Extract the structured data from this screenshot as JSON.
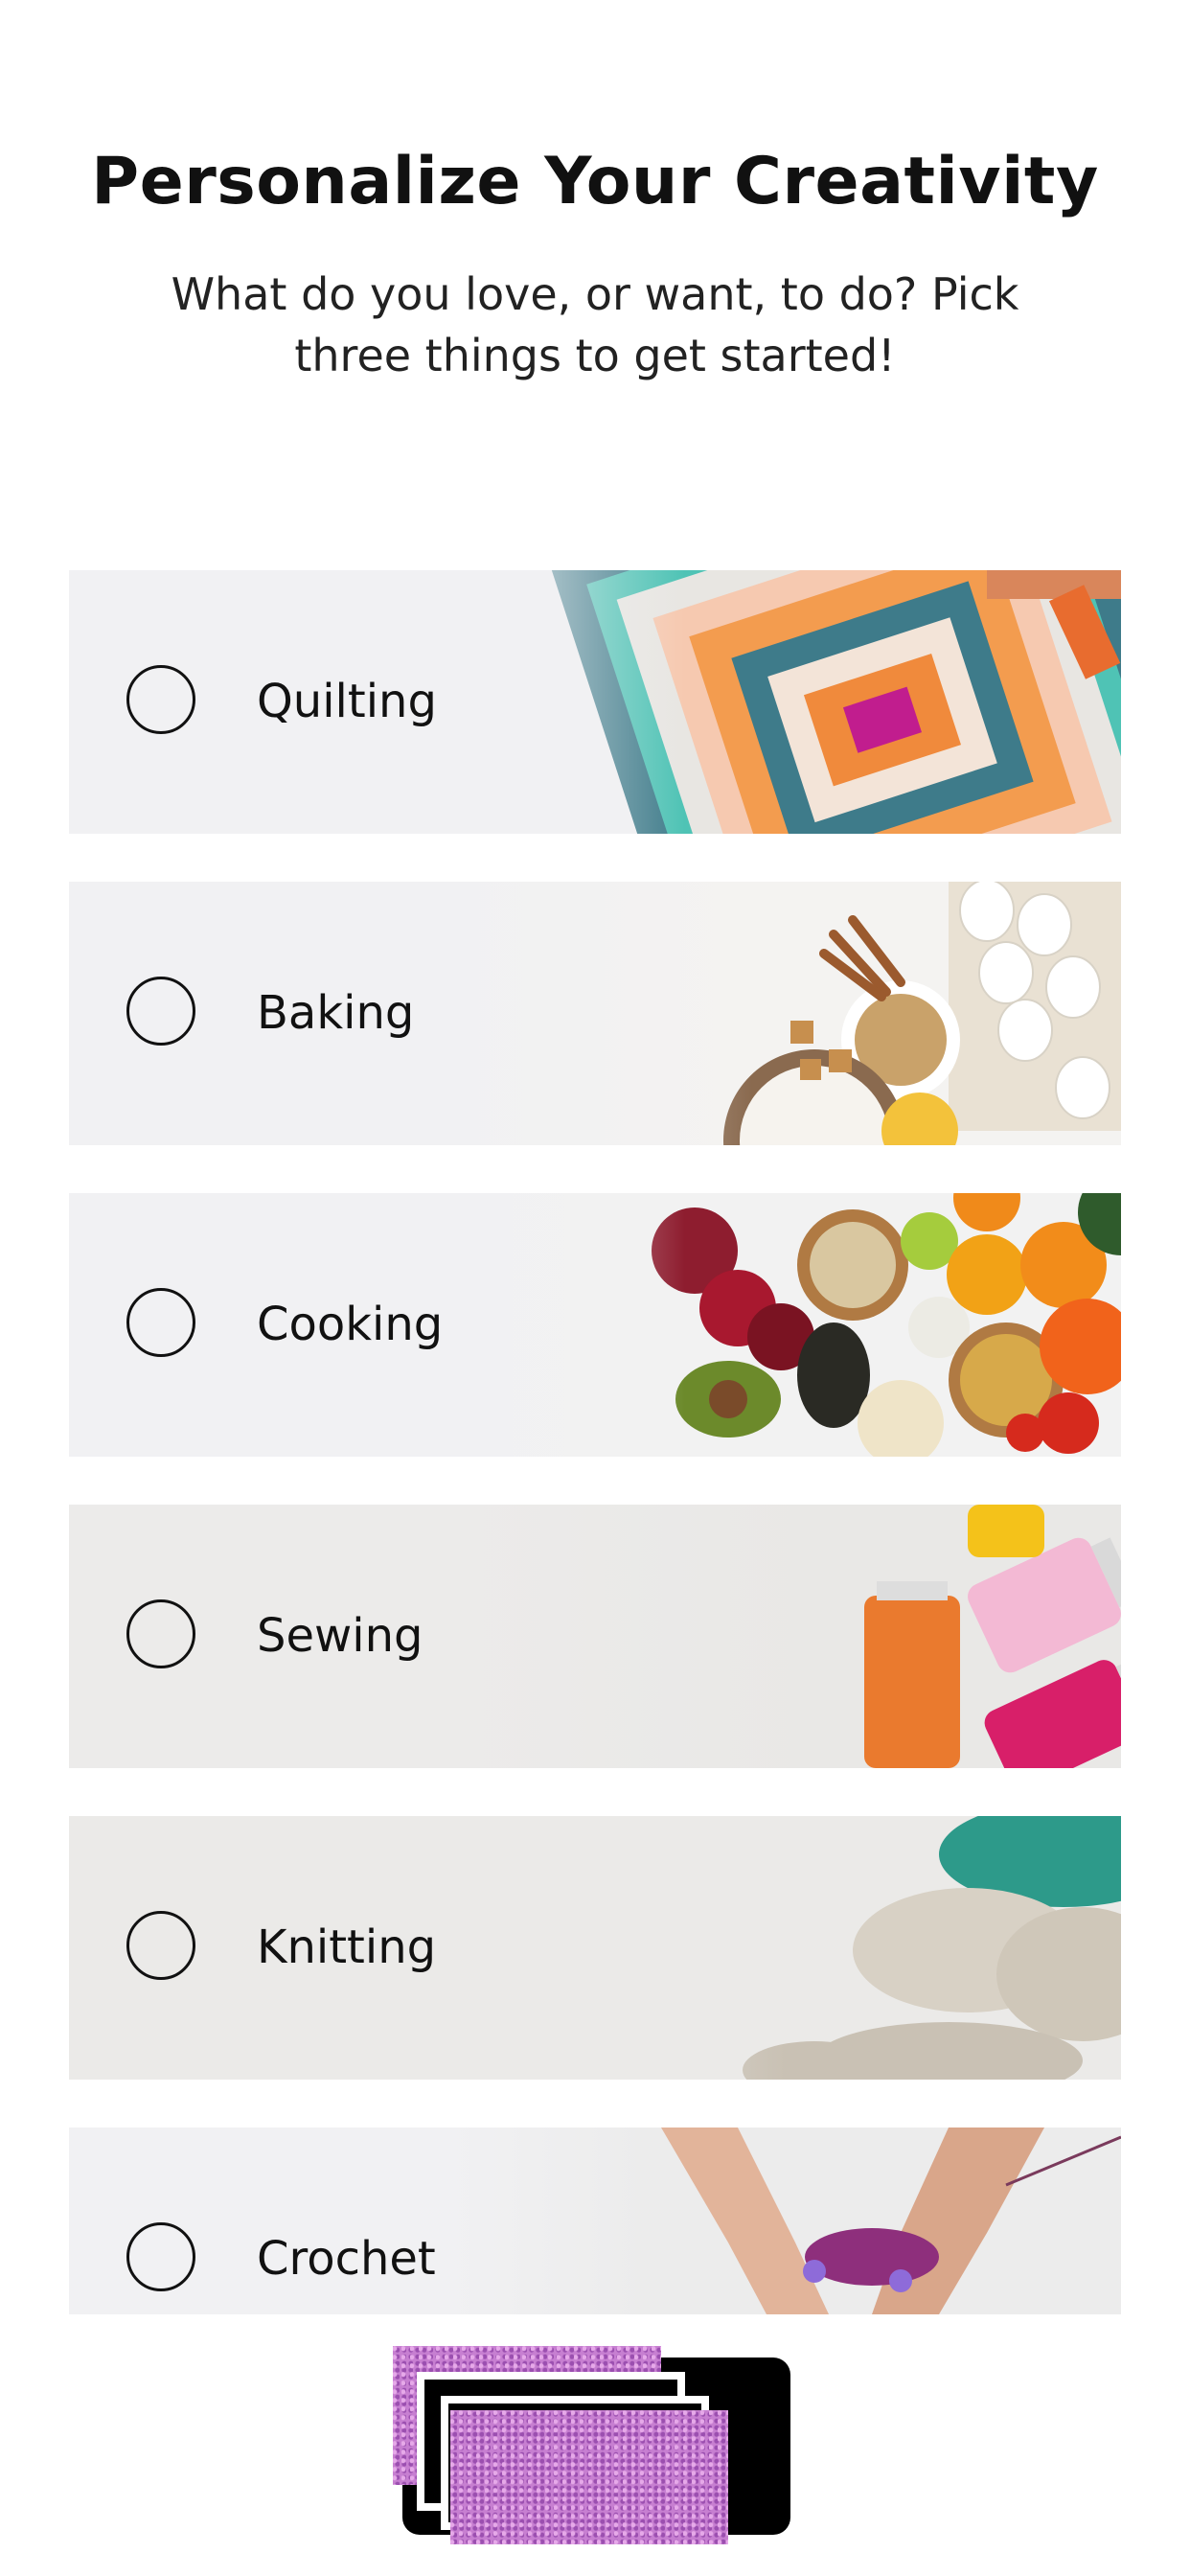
{
  "header": {
    "title": "Personalize Your Creativity",
    "subtitle": "What do you love, or want, to do? Pick three things to get started!"
  },
  "options": [
    {
      "label": "Quilting",
      "selected": false,
      "art": "quilt-image"
    },
    {
      "label": "Baking",
      "selected": false,
      "art": "baking-ingredients-image"
    },
    {
      "label": "Cooking",
      "selected": false,
      "art": "vegetables-image"
    },
    {
      "label": "Sewing",
      "selected": false,
      "art": "thread-spools-image"
    },
    {
      "label": "Knitting",
      "selected": false,
      "art": "yarn-skeins-image"
    },
    {
      "label": "Crochet",
      "selected": false,
      "art": "crochet-hands-image"
    }
  ],
  "colors": {
    "card_background": "#f1f1f3",
    "text": "#111111",
    "accent_glitter": "#c77fd1"
  }
}
